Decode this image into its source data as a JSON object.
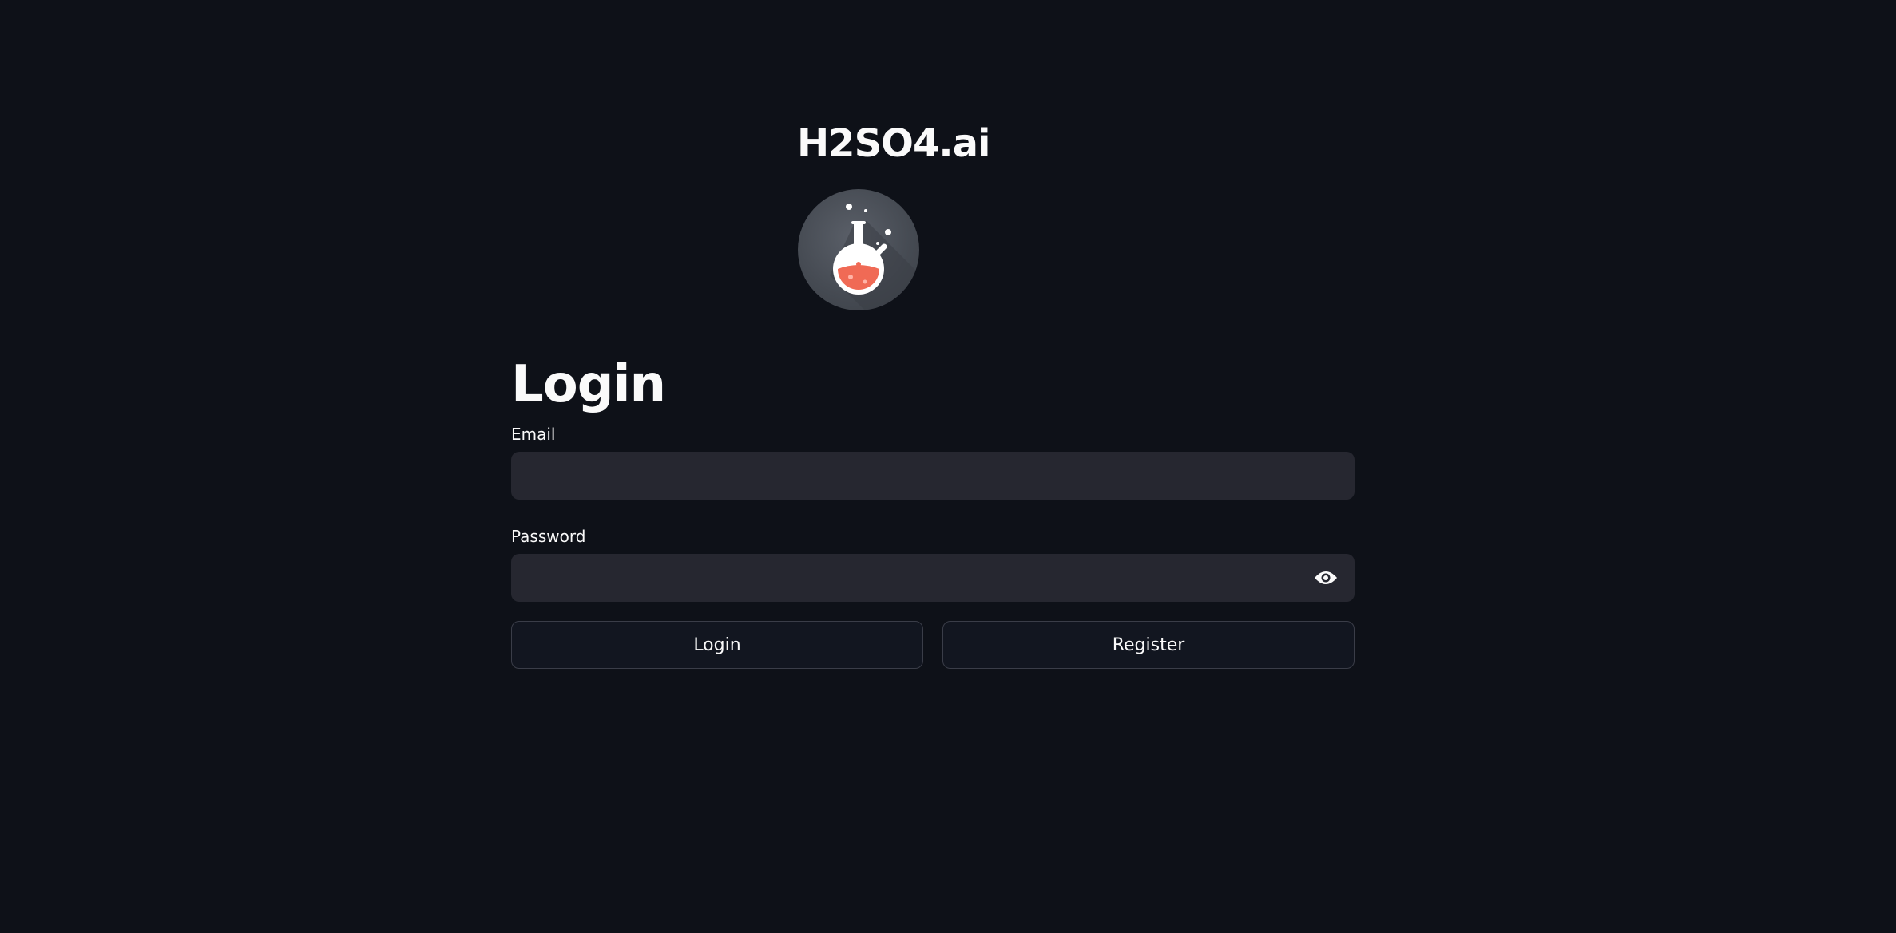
{
  "brand": {
    "title": "H2SO4.ai",
    "logo_icon": "flask-icon"
  },
  "login_form": {
    "heading": "Login",
    "email": {
      "label": "Email",
      "value": "",
      "placeholder": ""
    },
    "password": {
      "label": "Password",
      "value": "",
      "placeholder": "",
      "toggle_icon": "eye-icon"
    },
    "login_button": "Login",
    "register_button": "Register"
  },
  "colors": {
    "background": "#0e1118",
    "input_background": "#262730",
    "button_background": "#121620",
    "text": "#fafafa",
    "flask_liquid": "#f06a55"
  }
}
